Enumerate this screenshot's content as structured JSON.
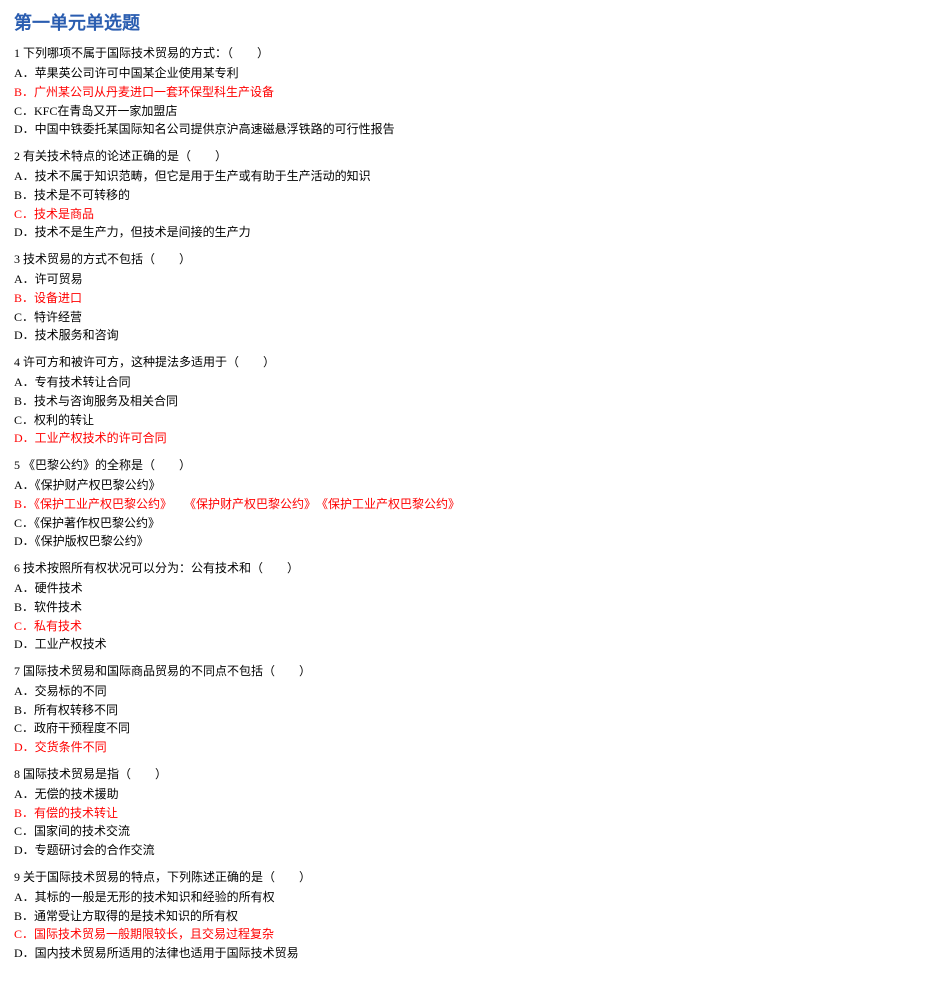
{
  "title": "第一单元单选题",
  "questions": [
    {
      "num": "1",
      "stem": "下列哪项不属于国际技术贸易的方式：（　　）",
      "options": [
        {
          "letter": "A．",
          "text": "苹果英公司许可中国某企业使用某专利",
          "correct": false
        },
        {
          "letter": "B．",
          "text": "广州某公司从丹麦进口一套环保型科生产设备",
          "correct": true
        },
        {
          "letter": "C．",
          "text": "KFC在青岛又开一家加盟店",
          "correct": false
        },
        {
          "letter": "D．",
          "text": "中国中铁委托某国际知名公司提供京沪高速磁悬浮铁路的可行性报告",
          "correct": false
        }
      ]
    },
    {
      "num": "2",
      "stem": "有关技术特点的论述正确的是（　　）",
      "options": [
        {
          "letter": "A．",
          "text": "技术不属于知识范畴，但它是用于生产或有助于生产活动的知识",
          "correct": false
        },
        {
          "letter": "B．",
          "text": "技术是不可转移的",
          "correct": false
        },
        {
          "letter": "C．",
          "text": "技术是商品",
          "correct": true
        },
        {
          "letter": "D．",
          "text": "技术不是生产力，但技术是间接的生产力",
          "correct": false
        }
      ]
    },
    {
      "num": "3",
      "stem": "技术贸易的方式不包括（　　）",
      "options": [
        {
          "letter": "A．",
          "text": "许可贸易",
          "correct": false
        },
        {
          "letter": "B．",
          "text": "设备进口",
          "correct": true
        },
        {
          "letter": "C．",
          "text": "特许经营",
          "correct": false
        },
        {
          "letter": "D．",
          "text": "技术服务和咨询",
          "correct": false
        }
      ]
    },
    {
      "num": "4",
      "stem": "许可方和被许可方，这种提法多适用于（　　）",
      "options": [
        {
          "letter": "A．",
          "text": "专有技术转让合同",
          "correct": false
        },
        {
          "letter": "B．",
          "text": "技术与咨询服务及相关合同",
          "correct": false
        },
        {
          "letter": "C．",
          "text": "权利的转让",
          "correct": false
        },
        {
          "letter": "D．",
          "text": "工业产权技术的许可合同",
          "correct": true
        }
      ]
    },
    {
      "num": "5",
      "stem": "《巴黎公约》的全称是（　　）",
      "options": [
        {
          "letter": "A．",
          "text": "《保护财产权巴黎公约》",
          "correct": false
        },
        {
          "letter": "B．",
          "text": "《保护工业产权巴黎公约》　　《保护财产权巴黎公约》　《保护工业产权巴黎公约》",
          "correct": true
        },
        {
          "letter": "C．",
          "text": "《保护著作权巴黎公约》",
          "correct": false
        },
        {
          "letter": "D．",
          "text": "《保护版权巴黎公约》",
          "correct": false
        }
      ]
    },
    {
      "num": "6",
      "stem": "技术按照所有权状况可以分为：公有技术和（　　）",
      "options": [
        {
          "letter": "A．",
          "text": "硬件技术",
          "correct": false
        },
        {
          "letter": "B．",
          "text": "软件技术",
          "correct": false
        },
        {
          "letter": "C．",
          "text": "私有技术",
          "correct": true
        },
        {
          "letter": "D．",
          "text": "工业产权技术",
          "correct": false
        }
      ]
    },
    {
      "num": "7",
      "stem": "国际技术贸易和国际商品贸易的不同点不包括（　　）",
      "options": [
        {
          "letter": "A．",
          "text": "交易标的不同",
          "correct": false
        },
        {
          "letter": "B．",
          "text": "所有权转移不同",
          "correct": false
        },
        {
          "letter": "C．",
          "text": "政府干预程度不同",
          "correct": false
        },
        {
          "letter": "D．",
          "text": "交货条件不同",
          "correct": true
        }
      ]
    },
    {
      "num": "8",
      "stem": "国际技术贸易是指（　　）",
      "options": [
        {
          "letter": "A．",
          "text": "无偿的技术援助",
          "correct": false
        },
        {
          "letter": "B．",
          "text": "有偿的技术转让",
          "correct": true
        },
        {
          "letter": "C．",
          "text": "国家间的技术交流",
          "correct": false
        },
        {
          "letter": "D．",
          "text": "专题研讨会的合作交流",
          "correct": false
        }
      ]
    },
    {
      "num": "9",
      "stem": "关于国际技术贸易的特点，下列陈述正确的是（　　）",
      "options": [
        {
          "letter": "A．",
          "text": "其标的一般是无形的技术知识和经验的所有权",
          "correct": false
        },
        {
          "letter": "B．",
          "text": "通常受让方取得的是技术知识的所有权",
          "correct": false
        },
        {
          "letter": "C．",
          "text": "国际技术贸易一般期限较长，且交易过程复杂",
          "correct": true
        },
        {
          "letter": "D．",
          "text": "国内技术贸易所适用的法律也适用于国际技术贸易",
          "correct": false
        }
      ]
    }
  ]
}
